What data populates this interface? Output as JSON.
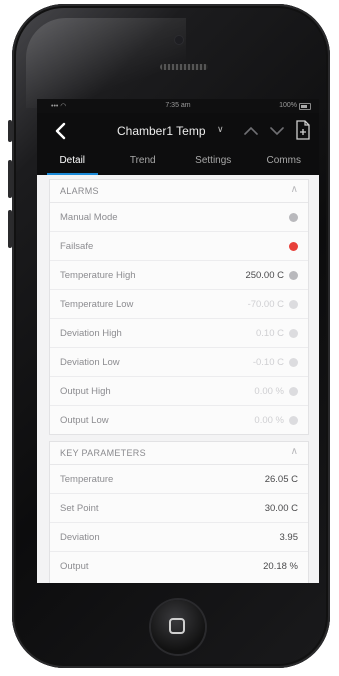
{
  "status_bar": {
    "signal": "••• ◠",
    "time": "7:35 am",
    "battery": "100%"
  },
  "app_bar": {
    "title": "Chamber1 Temp",
    "title_caret": "∨",
    "back_icon": "chevron-left",
    "nav_up_icon": "chevron-up",
    "nav_down_icon": "chevron-down",
    "doc_icon": "document-add"
  },
  "tabs": [
    {
      "label": "Detail",
      "active": true
    },
    {
      "label": "Trend",
      "active": false
    },
    {
      "label": "Settings",
      "active": false
    },
    {
      "label": "Comms",
      "active": false
    }
  ],
  "alarms": {
    "title": "ALARMS",
    "chevron": "∧",
    "rows": [
      {
        "label": "Manual Mode",
        "value": "",
        "indicator": "gray"
      },
      {
        "label": "Failsafe",
        "value": "",
        "indicator": "red"
      },
      {
        "label": "Temperature High",
        "value": "250.00 C",
        "indicator": "gray"
      },
      {
        "label": "Temperature Low",
        "value": "-70.00 C",
        "indicator": "faint"
      },
      {
        "label": "Deviation High",
        "value": "0.10 C",
        "indicator": "faint"
      },
      {
        "label": "Deviation Low",
        "value": "-0.10 C",
        "indicator": "faint"
      },
      {
        "label": "Output High",
        "value": "0.00 %",
        "indicator": "faint"
      },
      {
        "label": "Output Low",
        "value": "0.00 %",
        "indicator": "faint"
      }
    ]
  },
  "key_parameters": {
    "title": "KEY PARAMETERS",
    "chevron": "∧",
    "rows": [
      {
        "label": "Temperature",
        "value": "26.05 C"
      },
      {
        "label": "Set Point",
        "value": "30.00 C"
      },
      {
        "label": "Deviation",
        "value": "3.95"
      },
      {
        "label": "Output",
        "value": "20.18 %"
      }
    ]
  },
  "colors": {
    "accent": "#1a8ad8",
    "alarm_red": "#e8403a",
    "indicator_gray": "#b9b9bd"
  }
}
